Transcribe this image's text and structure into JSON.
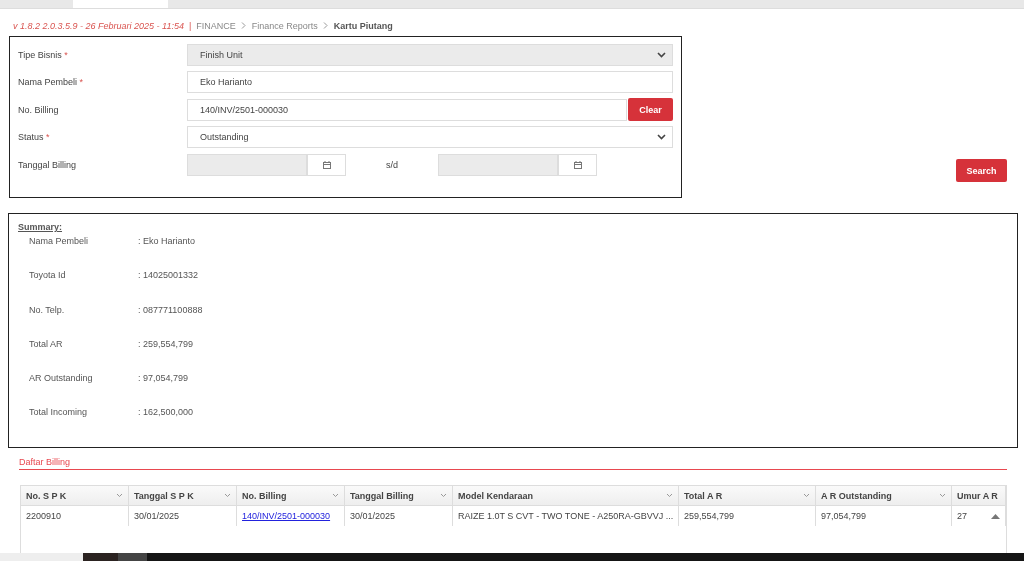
{
  "breadcrumb": {
    "version": "v 1.8.2 2.0.3.5.9 - 26 Februari 2025 - 11:54",
    "separator": "|",
    "items": [
      "FINANCE",
      "Finance Reports",
      "Kartu Piutang"
    ]
  },
  "form": {
    "fields": [
      {
        "kind": "select",
        "label": "Tipe Bisnis",
        "required_mark": "*",
        "value": "Finish Unit",
        "disabled": true
      },
      {
        "kind": "text",
        "label": "Nama Pembeli",
        "required_mark": "*",
        "value": "Eko Harianto"
      },
      {
        "kind": "text-clear",
        "label": "No. Billing",
        "value": "140/INV/2501-000030",
        "button": "Clear"
      },
      {
        "kind": "select",
        "label": "Status",
        "required_mark": "*",
        "value": "Outstanding",
        "disabled": false
      },
      {
        "kind": "daterange",
        "label": "Tanggal Billing",
        "between": "s/d"
      }
    ],
    "search_button": "Search"
  },
  "summary": {
    "title": "Summary:",
    "rows": [
      {
        "label": "Nama Pembeli",
        "value": ": Eko Harianto"
      },
      {
        "label": "Toyota Id",
        "value": ": 14025001332"
      },
      {
        "label": "No. Telp.",
        "value": ": 087771100888"
      },
      {
        "label": "Total AR",
        "value": ": 259,554,799"
      },
      {
        "label": "AR Outstanding",
        "value": ": 97,054,799"
      },
      {
        "label": "Total Incoming",
        "value": ": 162,500,000"
      }
    ]
  },
  "billing": {
    "title": "Daftar Billing",
    "table": {
      "columns": [
        {
          "label": "No. S P K",
          "menu": true,
          "link": false
        },
        {
          "label": "Tanggal S P K",
          "menu": true,
          "link": false
        },
        {
          "label": "No. Billing",
          "menu": true,
          "link": true
        },
        {
          "label": "Tanggal Billing",
          "menu": true,
          "link": false
        },
        {
          "label": "Model Kendaraan",
          "menu": true,
          "link": false
        },
        {
          "label": "Total A R",
          "menu": true,
          "link": false
        },
        {
          "label": "A R Outstanding",
          "menu": true,
          "link": false
        },
        {
          "label": "Umur A R",
          "menu": false,
          "link": false
        }
      ],
      "rows": [
        {
          "cells": [
            "2200910",
            "30/01/2025",
            "140/INV/2501-000030",
            "30/01/2025",
            "RAIZE 1.0T S CVT - TWO TONE - A250RA-GBVVJ ...",
            "259,554,799",
            "97,054,799",
            "27"
          ]
        }
      ]
    }
  }
}
